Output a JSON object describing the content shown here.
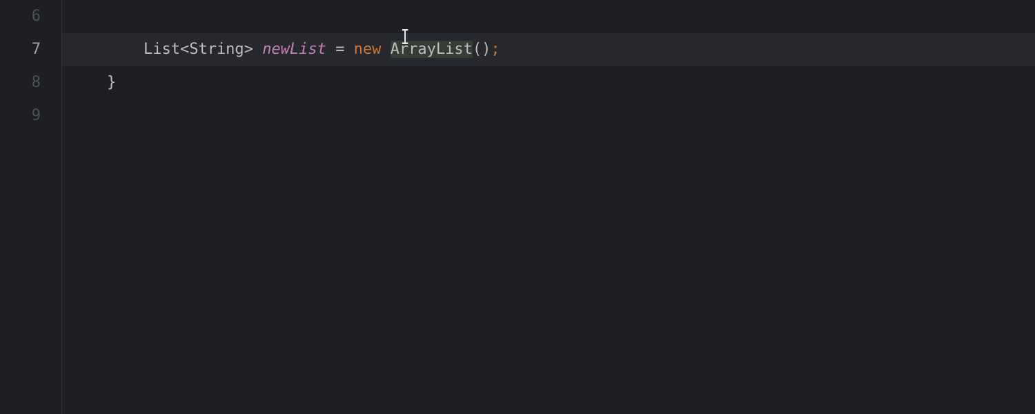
{
  "gutter": {
    "lines": [
      "6",
      "7",
      "8",
      "9"
    ],
    "activeIndex": 1
  },
  "code": {
    "line6": "",
    "line7": {
      "indent": "        ",
      "t_list": "List",
      "t_lt": "<",
      "t_string": "String",
      "t_gt": ">",
      "t_space1": " ",
      "t_var": "newList",
      "t_space2": " ",
      "t_eq": "=",
      "t_space3": " ",
      "t_new": "new",
      "t_space4": " ",
      "t_arraylist": "ArrayList",
      "t_lparen": "(",
      "t_rparen": ")",
      "t_semi": ";"
    },
    "line8": {
      "indent": "    ",
      "t_brace": "}"
    },
    "line9": ""
  },
  "cursor_glyph": "I"
}
